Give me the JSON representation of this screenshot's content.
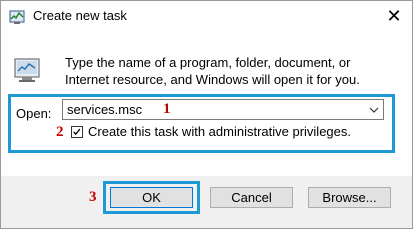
{
  "window": {
    "title": "Create new task",
    "close_glyph": "✕"
  },
  "description": "Type the name of a program, folder, document, or Internet resource, and Windows will open it for you.",
  "open": {
    "label": "Open:",
    "value": "services.msc"
  },
  "admin_checkbox": {
    "label": "Create this task with administrative privileges.",
    "checked": true
  },
  "annotations": {
    "step1": "1",
    "step2": "2",
    "step3": "3"
  },
  "buttons": {
    "ok": "OK",
    "cancel": "Cancel",
    "browse": "Browse..."
  },
  "colors": {
    "highlight": "#1d9ad6",
    "annotation": "#c00000"
  },
  "icons": {
    "title": "task-manager-icon",
    "run": "run-dialog-icon",
    "dropdown": "chevron-down-icon",
    "check": "checkmark-icon",
    "close": "close-icon"
  }
}
